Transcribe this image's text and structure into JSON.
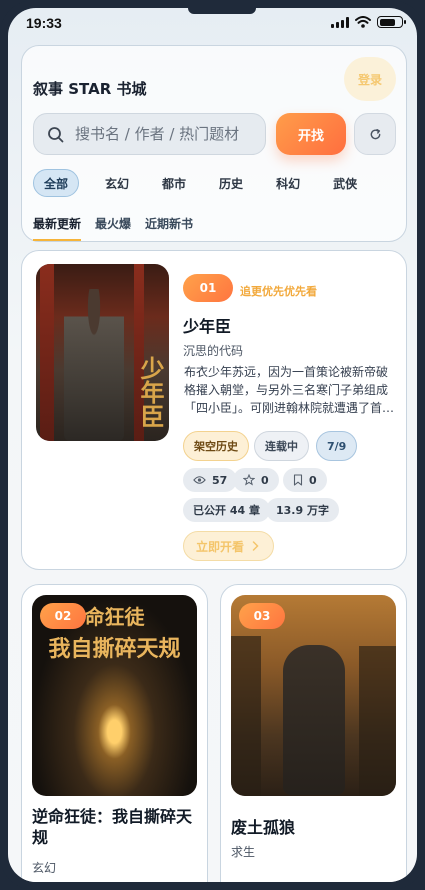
{
  "status": {
    "time": "19:33"
  },
  "header": {
    "title": "叙事 STAR 书城",
    "login_label": "登录",
    "search": {
      "placeholder": "搜书名 / 作者 / 热门题材",
      "button_label": "开找"
    },
    "categories": [
      {
        "label": "全部",
        "active": true
      },
      {
        "label": "玄幻"
      },
      {
        "label": "都市"
      },
      {
        "label": "历史"
      },
      {
        "label": "科幻"
      },
      {
        "label": "武侠"
      }
    ],
    "sort_tabs": [
      {
        "label": "最新更新",
        "active": true
      },
      {
        "label": "最火爆"
      },
      {
        "label": "近期新书"
      }
    ]
  },
  "featured": {
    "rank": "01",
    "rank_note": "追更优先优先看",
    "title": "少年臣",
    "author": "沉思的代码",
    "description": "布衣少年苏远，因为一首策论被新帝破格擢入朝堂，与另外三名寒门子弟组成「四小臣」。可刚进翰林院就遭遇了首…",
    "cover_text": "少年臣",
    "tags": {
      "genre": "架空历史",
      "status": "连载中",
      "count": "7/9"
    },
    "stats": {
      "views": "57",
      "stars": "0",
      "bookmarks": "0"
    },
    "meta": {
      "chapters": "已公开 44 章",
      "words": "13.9 万字"
    },
    "read_label": "立即开看"
  },
  "grid": [
    {
      "rank": "02",
      "title": "逆命狂徒：我自撕碎天规",
      "author": "玄幻",
      "cover_lines": [
        "命狂徒",
        "我自撕碎天规"
      ]
    },
    {
      "rank": "03",
      "title": "废土孤狼",
      "author": "求生"
    }
  ],
  "colors": {
    "accent": "#ff7a40",
    "gold": "#f6b43a",
    "chip_blue": "#d5e6f4"
  }
}
